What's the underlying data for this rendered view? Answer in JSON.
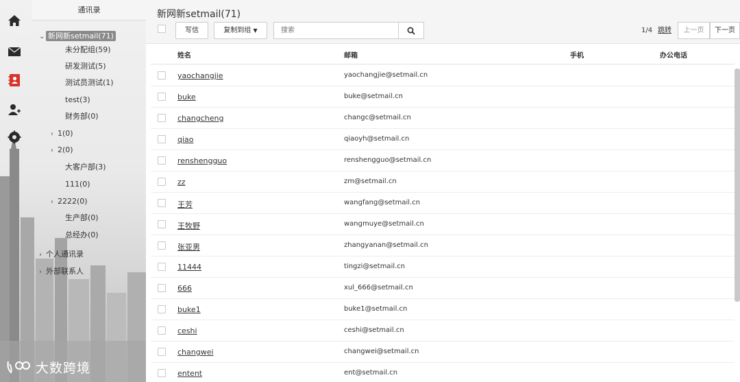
{
  "sidebar": {
    "header": "通讯录",
    "tree": [
      {
        "arrow": "⌄",
        "label": "新网新setmail(71)",
        "root": true
      },
      {
        "arrow": "",
        "label": "未分配组(59)"
      },
      {
        "arrow": "",
        "label": "研发测试(5)"
      },
      {
        "arrow": "",
        "label": "测试员测试(1)"
      },
      {
        "arrow": "",
        "label": "test(3)"
      },
      {
        "arrow": "",
        "label": "财务部(0)"
      },
      {
        "arrow": "›",
        "label": "1(0)"
      },
      {
        "arrow": "›",
        "label": "2(0)"
      },
      {
        "arrow": "",
        "label": "大客户部(3)"
      },
      {
        "arrow": "",
        "label": "111(0)"
      },
      {
        "arrow": "›",
        "label": "2222(0)"
      },
      {
        "arrow": "",
        "label": "生产部(0)"
      },
      {
        "arrow": "",
        "label": "总经办(0)"
      },
      {
        "arrow": "›",
        "label": "个人通讯录"
      },
      {
        "arrow": "›",
        "label": "外部联系人"
      }
    ],
    "icons": [
      "home-icon",
      "mail-icon",
      "contacts-icon",
      "add-user-icon",
      "settings-icon"
    ]
  },
  "watermark": "大数跨境",
  "main": {
    "title": "新网新setmail(71)",
    "write_label": "写信",
    "copy_label": "复制到组",
    "search_placeholder": "搜索",
    "page_info": "1/4",
    "jump_label": "跳转",
    "prev_label": "上一页",
    "next_label": "下一页",
    "columns": [
      "姓名",
      "邮箱",
      "手机",
      "办公电话"
    ],
    "rows": [
      {
        "name": "yaochangjie",
        "email": "yaochangjie@setmail.cn"
      },
      {
        "name": "buke",
        "email": "buke@setmail.cn"
      },
      {
        "name": "changcheng",
        "email": "changc@setmail.cn"
      },
      {
        "name": "qiao",
        "email": "qiaoyh@setmail.cn"
      },
      {
        "name": "renshengguo",
        "email": "renshengguo@setmail.cn"
      },
      {
        "name": "zz",
        "email": "zm@setmail.cn"
      },
      {
        "name": "王芳",
        "email": "wangfang@setmail.cn"
      },
      {
        "name": "王牧野",
        "email": "wangmuye@setmail.cn"
      },
      {
        "name": "张亚男",
        "email": "zhangyanan@setmail.cn"
      },
      {
        "name": "11444",
        "email": "tingzi@setmail.cn"
      },
      {
        "name": "666",
        "email": "xul_666@setmail.cn"
      },
      {
        "name": "buke1",
        "email": "buke1@setmail.cn"
      },
      {
        "name": "ceshi",
        "email": "ceshi@setmail.cn"
      },
      {
        "name": "changwei",
        "email": "changwei@setmail.cn"
      },
      {
        "name": "entent",
        "email": "ent@setmail.cn"
      }
    ]
  }
}
